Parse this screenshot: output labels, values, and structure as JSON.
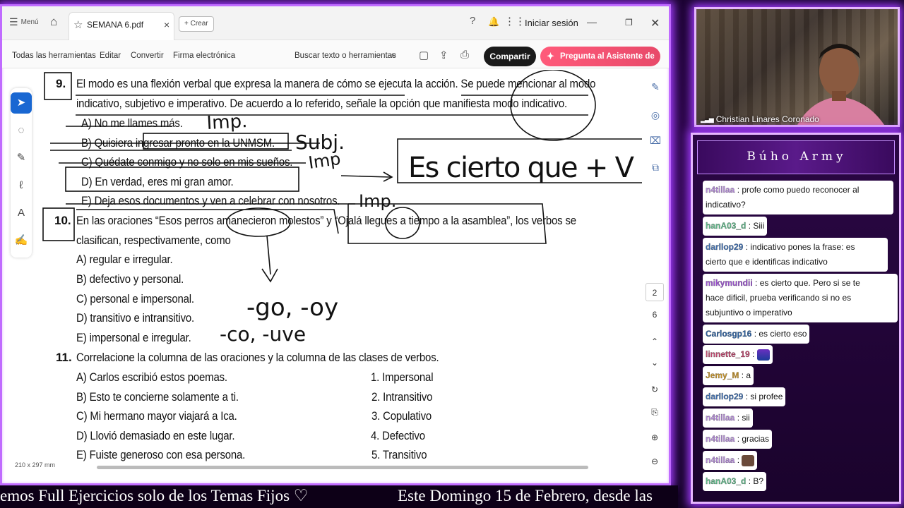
{
  "window": {
    "menu_label": "Menú",
    "tab_name": "SEMANA 6.pdf",
    "new_tab_label": "+ Crear",
    "signin_label": "Iniciar sesión"
  },
  "toolbar": {
    "all_tools": "Todas las herramientas",
    "edit": "Editar",
    "convert": "Convertir",
    "esign": "Firma electrónica",
    "search": "Buscar texto o herramientas",
    "share": "Compartir",
    "ai": "Pregunta al Asistente de IA"
  },
  "page_nav": {
    "current": "2",
    "total": "6"
  },
  "status": {
    "page_size": "210 x 297 mm"
  },
  "doc": {
    "q9": {
      "number": "9.",
      "line1": "El modo es una flexión verbal que expresa la manera de cómo se ejecuta la acción. Se puede mencionar al modo",
      "line2": "indicativo, subjetivo e imperativo. De acuerdo a lo referido, señale la opción que manifiesta modo indicativo.",
      "options": [
        "A)   No me llames más.",
        "B)   Quisiera ingresar pronto en la UNMSM.",
        "C)   Quédate conmigo y no solo en mis sueños.",
        "D)   En verdad, eres mi gran amor.",
        "E)   Deja esos documentos y ven a celebrar con nosotros."
      ]
    },
    "q10": {
      "number": "10.",
      "line1": "En las oraciones “Esos perros amanecieron molestos” y “Ojalá llegues a tiempo a la asamblea”, los verbos se",
      "line2": "clasifican, respectivamente, como",
      "options": [
        "A) regular e irregular.",
        "B) defectivo y personal.",
        "C) personal e impersonal.",
        "D) transitivo e intransitivo.",
        "E) impersonal e irregular."
      ]
    },
    "q11": {
      "number": "11.",
      "line1": "Correlacione la columna de las oraciones y la columna de las clases de verbos.",
      "left": [
        "A) Carlos escribió estos poemas.",
        "B) Esto te concierne solamente a ti.",
        "C) Mi hermano mayor viajará a Ica.",
        "D) Llovió demasiado en este lugar.",
        "E) Fuiste generoso con esa persona."
      ],
      "right": [
        "1. Impersonal",
        "2. Intransitivo",
        "3. Copulativo",
        "4. Defectivo",
        "5. Transitivo"
      ]
    }
  },
  "marquee": {
    "left": "emos Full Ejercicios solo de los Temas Fijos ♡",
    "right": "Este Domingo 15 de Febrero, desde las"
  },
  "webcam": {
    "name": "Christian Linares Coronado"
  },
  "chat": {
    "title": "Búho Army",
    "messages": [
      {
        "user": "n4tillaa",
        "color": "#b388d9",
        "text": ": profe como puedo reconocer al indicativo?",
        "text2": "indicativo?"
      },
      {
        "user": "hanA03_d",
        "color": "#5fb889",
        "text": ": Siii"
      },
      {
        "user": "darllop29",
        "color": "#3f6fb0",
        "text": ": indicativo pones la frase: es",
        "text2": "cierto que e identificas indicativo"
      },
      {
        "user": "mikymundii",
        "color": "#9a4fd0",
        "text": ": es cierto que. Pero si se te",
        "text2": "hace dificil, prueba verificando si no es",
        "text3": "subjuntivo o imperativo"
      },
      {
        "user": "Carlosgp16",
        "color": "#2a5fa0",
        "text": ": es cierto eso"
      },
      {
        "user": "linnette_19",
        "color": "#c0476e",
        "text": ":"
      },
      {
        "user": "Jemy_M",
        "color": "#c9962a",
        "text": ": a"
      },
      {
        "user": "darllop29",
        "color": "#3f6fb0",
        "text": ": si profee"
      },
      {
        "user": "n4tillaa",
        "color": "#b388d9",
        "text": ": sii"
      },
      {
        "user": "n4tillaa",
        "color": "#b388d9",
        "text": ": gracias"
      },
      {
        "user": "n4tillaa",
        "color": "#b388d9",
        "text": ":"
      },
      {
        "user": "hanA03_d",
        "color": "#5fb889",
        "text": ": B?"
      }
    ]
  },
  "ink": {
    "q9_a": "Imp.",
    "q9_b": "Subj.",
    "q9_c": "Imp",
    "q9_e": "Imp.",
    "box": "Es cierto que + V",
    "suffix1": "-go, -oy",
    "suffix2": "-co, -uve"
  }
}
